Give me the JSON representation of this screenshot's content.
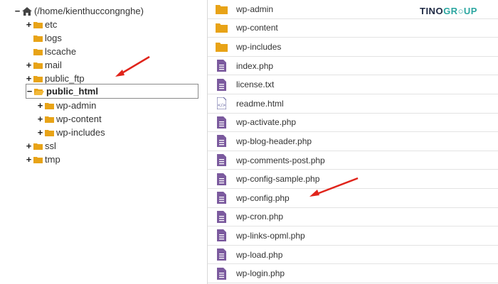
{
  "tree": {
    "root": {
      "toggle": "−",
      "label": "(/home/kienthuccongnghe)"
    },
    "items": [
      {
        "toggle": "+",
        "label": "etc"
      },
      {
        "toggle": "",
        "label": "logs"
      },
      {
        "toggle": "",
        "label": "lscache"
      },
      {
        "toggle": "+",
        "label": "mail"
      },
      {
        "toggle": "+",
        "label": "public_ftp"
      },
      {
        "toggle": "−",
        "label": "public_html"
      },
      {
        "toggle": "+",
        "label": "wp-admin"
      },
      {
        "toggle": "+",
        "label": "wp-content"
      },
      {
        "toggle": "+",
        "label": "wp-includes"
      },
      {
        "toggle": "+",
        "label": "ssl"
      },
      {
        "toggle": "+",
        "label": "tmp"
      }
    ]
  },
  "files": [
    {
      "name": "wp-admin",
      "icon": "folder-icon"
    },
    {
      "name": "wp-content",
      "icon": "folder-icon"
    },
    {
      "name": "wp-includes",
      "icon": "folder-icon"
    },
    {
      "name": "index.php",
      "icon": "php-file-icon"
    },
    {
      "name": "license.txt",
      "icon": "text-file-icon"
    },
    {
      "name": "readme.html",
      "icon": "html-file-icon"
    },
    {
      "name": "wp-activate.php",
      "icon": "php-file-icon"
    },
    {
      "name": "wp-blog-header.php",
      "icon": "php-file-icon"
    },
    {
      "name": "wp-comments-post.php",
      "icon": "php-file-icon"
    },
    {
      "name": "wp-config-sample.php",
      "icon": "php-file-icon"
    },
    {
      "name": "wp-config.php",
      "icon": "php-file-icon"
    },
    {
      "name": "wp-cron.php",
      "icon": "php-file-icon"
    },
    {
      "name": "wp-links-opml.php",
      "icon": "php-file-icon"
    },
    {
      "name": "wp-load.php",
      "icon": "php-file-icon"
    },
    {
      "name": "wp-login.php",
      "icon": "php-file-icon"
    }
  ],
  "logo": {
    "part1": "TINO",
    "part2": "GR",
    "part3": "UP"
  },
  "colors": {
    "folder": "#e8a317",
    "file": "#7b5a9e",
    "arrow": "#e0241b",
    "logo_accent": "#2aa6a0"
  }
}
